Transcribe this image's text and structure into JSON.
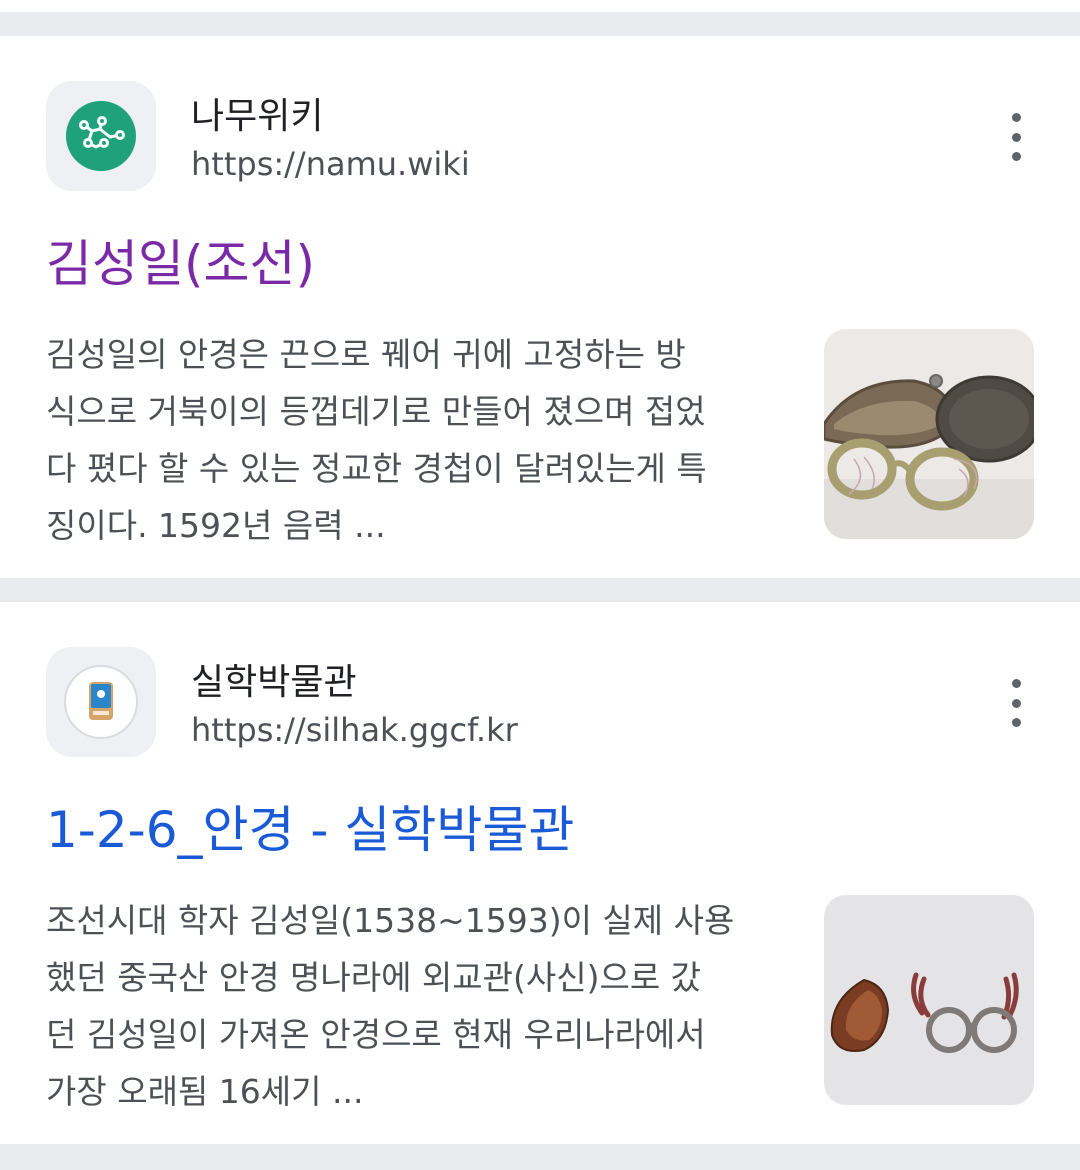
{
  "results": [
    {
      "site_name": "나무위키",
      "site_url": "https://namu.wiki",
      "title": "김성일(조선)",
      "title_color": "#7a2aa6",
      "favicon": "namu-wiki-logo-icon",
      "favicon_color": "#1fa27c",
      "snippet_lines": [
        "김성일의 안경은 끈으로 꿰어 귀에 고정하는 방",
        "식으로 거북이의 등껍데기로 만들어 졌으며 접었",
        "다 폈다 할 수 있는 정교한 경첩이 달려있는게 특",
        "징이다. 1592년 음력 ..."
      ],
      "thumbnail": "tortoiseshell-glasses-photo"
    },
    {
      "site_name": "실학박물관",
      "site_url": "https://silhak.ggcf.kr",
      "title": "1-2-6_안경 - 실학박물관",
      "title_color": "#1a5ad7",
      "favicon": "silhak-museum-logo-icon",
      "favicon_color": "#2a86c8",
      "snippet_lines": [
        "조선시대 학자 김성일(1538~1593)이 실제 사용",
        "했던 중국산 안경 명나라에 외교관(사신)으로 갔",
        "던 김성일이 가져온 안경으로 현재 우리나라에서",
        "가장 오래됨 16세기 ..."
      ],
      "thumbnail": "antique-glasses-with-case-photo"
    }
  ]
}
